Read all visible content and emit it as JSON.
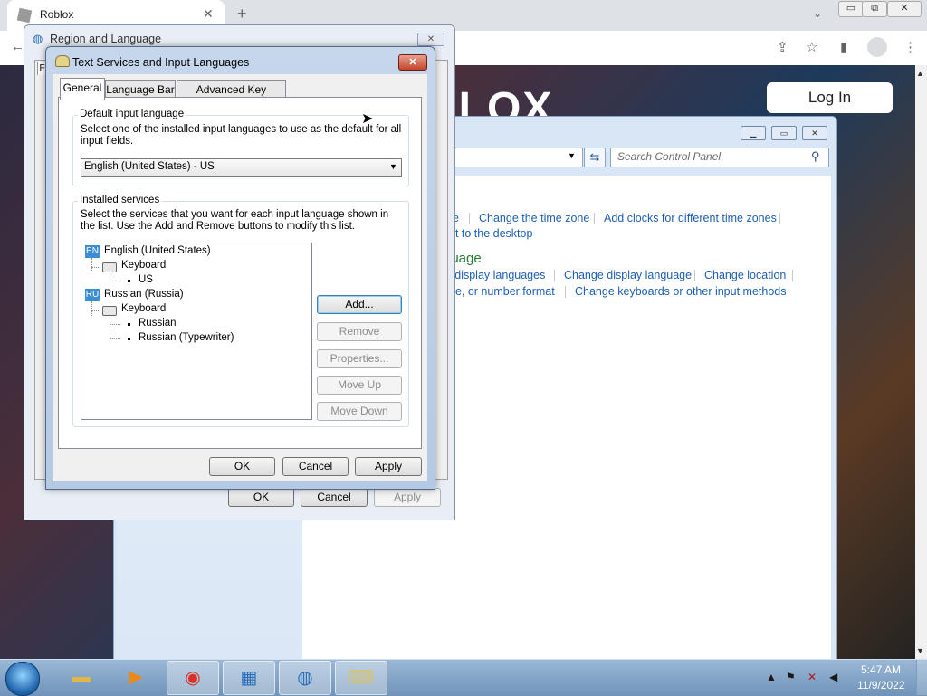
{
  "browser": {
    "tab_title": "Roblox",
    "tab_close": "✕",
    "new_tab": "+",
    "dropdown": "⌄",
    "win_min": "▭",
    "win_restore": "⧉",
    "win_close": "✕"
  },
  "roblox": {
    "logo_text": "BLOX",
    "login_label": "Log In"
  },
  "control_panel": {
    "search_placeholder": "Search Control Panel",
    "heading": "guage",
    "links_row1": [
      "e",
      "Change the time zone",
      "Add clocks for different time zones"
    ],
    "link_row2": "et to the desktop",
    "links_row3": [
      "l display languages",
      "Change display language",
      "Change location"
    ],
    "links_row4": [
      "ne, or number format",
      "Change keyboards or other input methods"
    ]
  },
  "region_dialog": {
    "title": "Region and Language",
    "close": "✕",
    "ok": "OK",
    "cancel": "Cancel",
    "apply": "Apply",
    "tab_letter": "F"
  },
  "text_services": {
    "title": "Text Services and Input Languages",
    "close": "✕",
    "tabs": [
      "General",
      "Language Bar",
      "Advanced Key Settings"
    ],
    "default_group_label": "Default input language",
    "default_desc": "Select one of the installed input languages to use as the default for all input fields.",
    "default_value": "English (United States) - US",
    "installed_group_label": "Installed services",
    "installed_desc": "Select the services that you want for each input language shown in the list. Use the Add and Remove buttons to modify this list.",
    "tree": {
      "lang1_badge": "EN",
      "lang1": "English (United States)",
      "lang1_kbd": "Keyboard",
      "lang1_layout": "US",
      "lang2_badge": "RU",
      "lang2": "Russian (Russia)",
      "lang2_kbd": "Keyboard",
      "lang2_layout1": "Russian",
      "lang2_layout2": "Russian (Typewriter)"
    },
    "buttons": {
      "add": "Add...",
      "remove": "Remove",
      "properties": "Properties...",
      "move_up": "Move Up",
      "move_down": "Move Down",
      "ok": "OK",
      "cancel": "Cancel",
      "apply": "Apply"
    }
  },
  "taskbar": {
    "time": "5:47 AM",
    "date": "11/9/2022"
  },
  "colors": {
    "accent_link": "#1d5fb2",
    "close_red": "#c3452b",
    "cp_heading_green": "#1e7d2f"
  }
}
